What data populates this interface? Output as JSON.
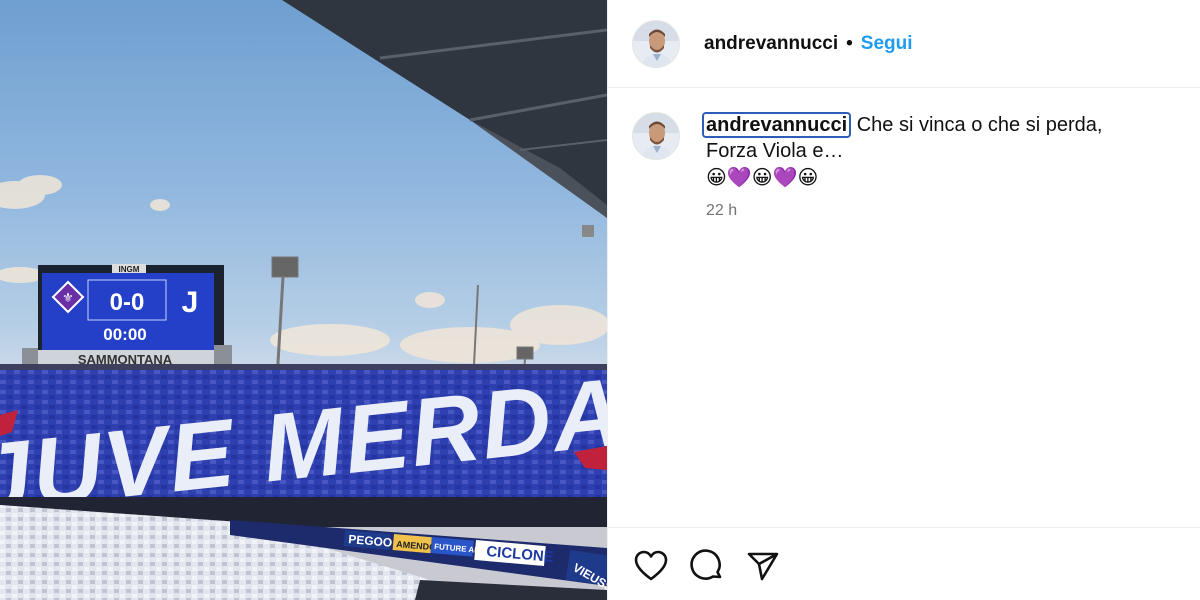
{
  "post": {
    "username": "andrevannucci",
    "separator": "•",
    "follow_label": "Segui"
  },
  "photo": {
    "scoreboard": {
      "logo_text": "INGM",
      "score": "0-0",
      "clock": "00:00",
      "sponsor": "SAMMONTANA"
    },
    "banner_text": "JUVE MERDA",
    "ad_boards": [
      "PEGOO",
      "AMENDOLA",
      "FUTURE ARTS",
      "CICLONE",
      "VIEUSS"
    ]
  },
  "caption": {
    "username": "andrevannucci",
    "text_line1": "Che si vinca o che si perda,",
    "text_line2": "Forza Viola e…",
    "emojis": "😀💜😀💜😀",
    "time": "22 h"
  },
  "actions": {
    "like_icon": "heart-icon",
    "comment_icon": "comment-icon",
    "share_icon": "share-icon"
  },
  "colors": {
    "follow": "#1f9cf0",
    "fiorentina_purple": "#5a2d91",
    "scoreboard_blue": "#1f3fb8"
  }
}
